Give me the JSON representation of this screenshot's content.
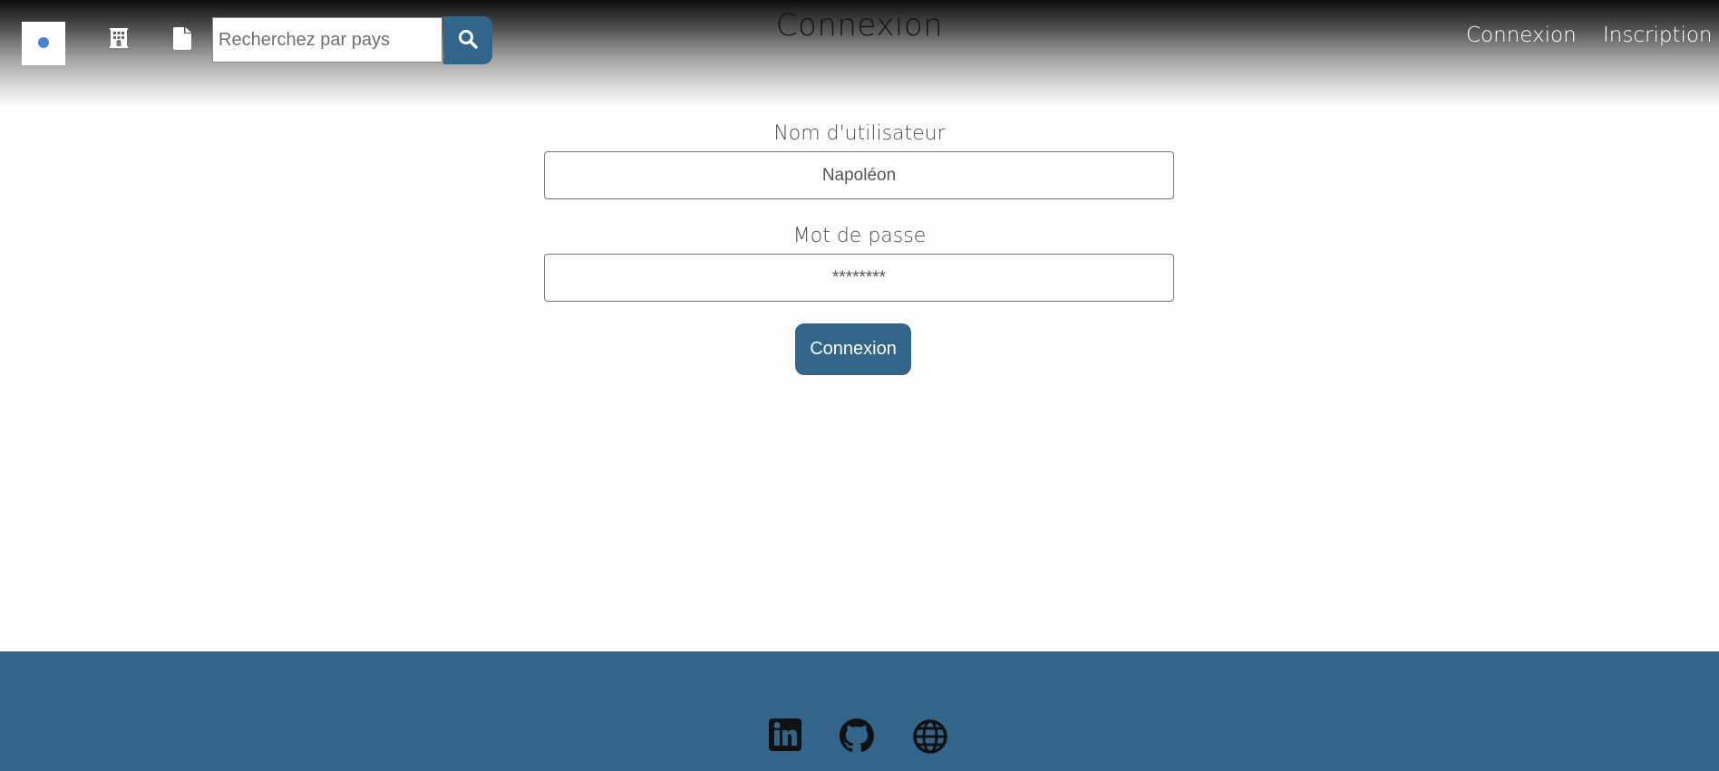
{
  "header": {
    "title": "Connexion",
    "search": {
      "placeholder": "Recherchez par pays",
      "value": ""
    },
    "nav": {
      "login_label": "Connexion",
      "signup_label": "Inscription"
    },
    "icons": {
      "hotel": "hotel-icon",
      "document": "document-icon",
      "search": "search-icon"
    }
  },
  "form": {
    "username_label": "Nom d'utilisateur",
    "username_value": "Napoléon",
    "password_label": "Mot de passe",
    "password_value": "********",
    "submit_label": "Connexion"
  },
  "footer": {
    "icons": [
      "linkedin-icon",
      "github-icon",
      "globe-icon"
    ]
  },
  "colors": {
    "accent": "#33658a",
    "header_top": "#0d0d0d",
    "background": "#fefefe"
  }
}
